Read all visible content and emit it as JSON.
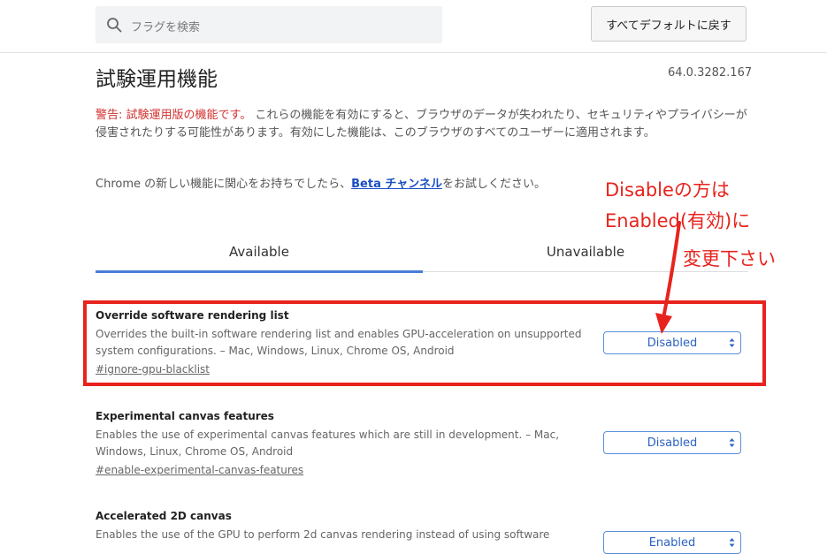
{
  "header": {
    "search_placeholder": "フラグを検索",
    "reset_label": "すべてデフォルトに戻す"
  },
  "page": {
    "title": "試験運用機能",
    "version": "64.0.3282.167"
  },
  "warning": {
    "label": "警告: 試験運用版の機能です。",
    "text": "これらの機能を有効にすると、ブラウザのデータが失われたり、セキュリティやプライバシーが侵害されたりする可能性があります。有効にした機能は、このブラウザのすべてのユーザーに適用されます。"
  },
  "beta": {
    "prefix": "Chrome の新しい機能に関心をお持ちでしたら、",
    "link": "Beta チャンネル",
    "suffix": "をお試しください。"
  },
  "tabs": [
    {
      "label": "Available",
      "active": true
    },
    {
      "label": "Unavailable",
      "active": false
    }
  ],
  "experiments": [
    {
      "title": "Override software rendering list",
      "description": "Overrides the built-in software rendering list and enables GPU-acceleration on unsupported system configurations. – Mac, Windows, Linux, Chrome OS, Android",
      "link": "#ignore-gpu-blacklist",
      "value": "Disabled"
    },
    {
      "title": "Experimental canvas features",
      "description": "Enables the use of experimental canvas features which are still in development. – Mac, Windows, Linux, Chrome OS, Android",
      "link": "#enable-experimental-canvas-features",
      "value": "Disabled"
    },
    {
      "title": "Accelerated 2D canvas",
      "description": "Enables the use of the GPU to perform 2d canvas rendering instead of using software",
      "link": "",
      "value": "Enabled"
    }
  ],
  "annotation": {
    "line1": "Disableの方は",
    "line2": "Enabled(有効)に",
    "line3": "変更下さい",
    "color": "#e8231d"
  },
  "colors": {
    "warning": "#d32f2f",
    "link": "#1a4ec2",
    "tab_indicator": "#4a7cd9",
    "select_text": "#2c62c4"
  }
}
